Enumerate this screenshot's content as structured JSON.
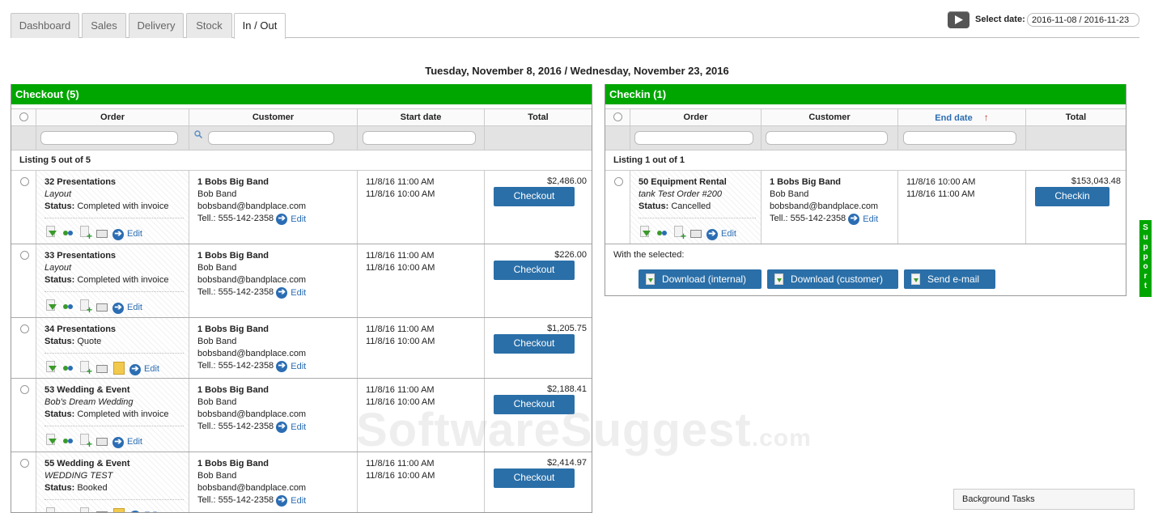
{
  "tabs": [
    "Dashboard",
    "Sales",
    "Delivery",
    "Stock",
    "In / Out"
  ],
  "active_tab": "In / Out",
  "date_select": {
    "label": "Select date:",
    "value": "2016-11-08 / 2016-11-23"
  },
  "range_title": "Tuesday, November 8, 2016 / Wednesday, November 23, 2016",
  "checkout": {
    "title": "Checkout (5)",
    "columns": [
      "Order",
      "Customer",
      "Start date",
      "Total"
    ],
    "listing": "Listing 5 out of 5",
    "button_label": "Checkout",
    "edit_label": "Edit",
    "rows": [
      {
        "order": "32 Presentations",
        "sub": "Layout",
        "status_label": "Status:",
        "status": " Completed with invoice",
        "customer": "1 Bobs Big Band",
        "contact": "Bob Band",
        "email": "bobsband@bandplace.com",
        "phone": "Tell.: 555-142-2358",
        "date1": "11/8/16 11:00 AM",
        "date2": "11/8/16 10:00 AM",
        "total": "$2,486.00"
      },
      {
        "order": "33 Presentations",
        "sub": "Layout",
        "status_label": "Status:",
        "status": " Completed with invoice",
        "customer": "1 Bobs Big Band",
        "contact": "Bob Band",
        "email": "bobsband@bandplace.com",
        "phone": "Tell.: 555-142-2358",
        "date1": "11/8/16 11:00 AM",
        "date2": "11/8/16 10:00 AM",
        "total": "$226.00"
      },
      {
        "order": "34 Presentations",
        "sub": "",
        "status_label": "Status:",
        "status": " Quote",
        "customer": "1 Bobs Big Band",
        "contact": "Bob Band",
        "email": "bobsband@bandplace.com",
        "phone": "Tell.: 555-142-2358",
        "date1": "11/8/16 11:00 AM",
        "date2": "11/8/16 10:00 AM",
        "total": "$1,205.75"
      },
      {
        "order": "53 Wedding & Event",
        "sub": "Bob's Dream Wedding",
        "status_label": "Status:",
        "status": " Completed with invoice",
        "customer": "1 Bobs Big Band",
        "contact": "Bob Band",
        "email": "bobsband@bandplace.com",
        "phone": "Tell.: 555-142-2358",
        "date1": "11/8/16 11:00 AM",
        "date2": "11/8/16 10:00 AM",
        "total": "$2,188.41"
      },
      {
        "order": "55 Wedding & Event",
        "sub": "WEDDING TEST",
        "status_label": "Status:",
        "status": " Booked",
        "customer": "1 Bobs Big Band",
        "contact": "Bob Band",
        "email": "bobsband@bandplace.com",
        "phone": "Tell.: 555-142-2358",
        "date1": "11/8/16 11:00 AM",
        "date2": "11/8/16 10:00 AM",
        "total": "$2,414.97"
      }
    ]
  },
  "checkin": {
    "title": "Checkin (1)",
    "columns": [
      "Order",
      "Customer",
      "End date",
      "Total"
    ],
    "sort_indicator": "↑",
    "listing": "Listing 1 out of 1",
    "button_label": "Checkin",
    "edit_label": "Edit",
    "row": {
      "order": "50 Equipment Rental",
      "sub": "tank Test Order #200",
      "status_label": "Status:",
      "status": " Cancelled",
      "customer": "1 Bobs Big Band",
      "contact": "Bob Band",
      "email": "bobsband@bandplace.com",
      "phone": "Tell.: 555-142-2358",
      "date1": "11/8/16 10:00 AM",
      "date2": "11/8/16 11:00 AM",
      "total": "$153,043.48"
    },
    "with_selected": "With the selected:",
    "actions": [
      "Download (internal)",
      "Download (customer)",
      "Send e-mail"
    ]
  },
  "watermark": {
    "main": "SoftwareSuggest",
    "suffix": ".com"
  },
  "support_label": "Support",
  "background_tasks": "Background Tasks",
  "colors": {
    "panel_header": "#00a600",
    "button": "#2a6fa8",
    "link": "#2b6db3",
    "sort_arrow": "#c0392b"
  }
}
